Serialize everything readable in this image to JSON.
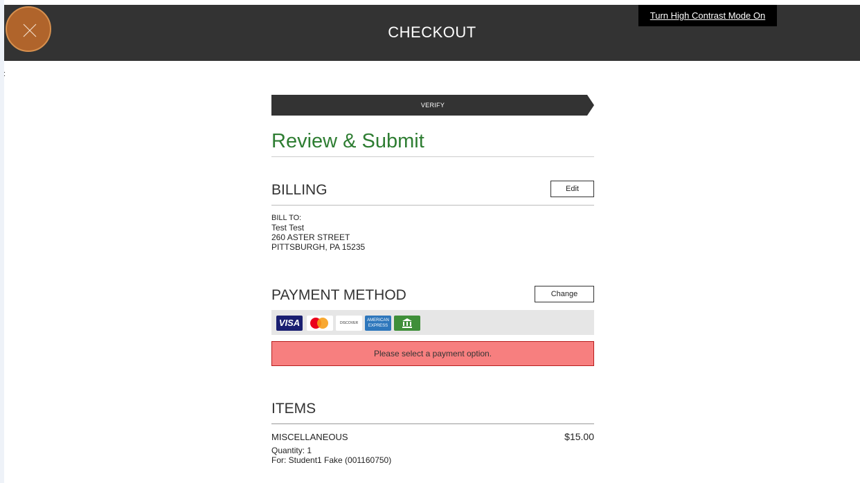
{
  "header": {
    "title": "CHECKOUT",
    "close_icon": "close-icon",
    "contrast_toggle": "Turn High Contrast Mode On"
  },
  "stray": ":",
  "progress": {
    "step": "VERIFY"
  },
  "page_title": "Review & Submit",
  "billing": {
    "heading": "BILLING",
    "edit_label": "Edit",
    "bill_to_label": "BILL TO:",
    "name": "Test Test",
    "street": "260 ASTER STREET",
    "city_line": "PITTSBURGH, PA 15235"
  },
  "payment": {
    "heading": "PAYMENT METHOD",
    "change_label": "Change",
    "cards": {
      "visa": "VISA",
      "discover": "DISCOVER",
      "amex_line1": "AMERICAN",
      "amex_line2": "EXPRESS"
    },
    "error": "Please select a payment option."
  },
  "items": {
    "heading": "ITEMS",
    "list": [
      {
        "name": "MISCELLANEOUS",
        "price": "$15.00",
        "quantity": "Quantity: 1",
        "for": "For: Student1 Fake (001160750)"
      }
    ]
  },
  "colors": {
    "header_bg": "#333333",
    "close_bg": "#b0642b",
    "title_green": "#2e7d32",
    "error_bg": "#f77f7f",
    "error_border": "#b71c1c"
  }
}
